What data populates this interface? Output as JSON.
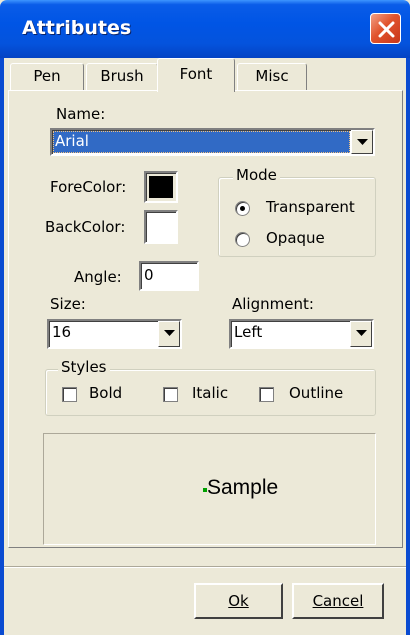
{
  "window": {
    "title": "Attributes",
    "close_label": "close"
  },
  "tabs": [
    {
      "label": "Pen",
      "active": false
    },
    {
      "label": "Brush",
      "active": false
    },
    {
      "label": "Font",
      "active": true
    },
    {
      "label": "Misc",
      "active": false
    }
  ],
  "font": {
    "name_label": "Name:",
    "name_value": "Arial",
    "forecolor_label": "ForeColor:",
    "forecolor": "#000000",
    "backcolor_label": "BackColor:",
    "backcolor": "#ffffff",
    "mode": {
      "title": "Mode",
      "options": [
        "Transparent",
        "Opaque"
      ],
      "selected": "Transparent"
    },
    "angle_label": "Angle:",
    "angle_value": "0",
    "size_label": "Size:",
    "size_value": "16",
    "alignment_label": "Alignment:",
    "alignment_value": "Left",
    "styles": {
      "title": "Styles",
      "options": [
        {
          "label": "Bold",
          "checked": false
        },
        {
          "label": "Italic",
          "checked": false
        },
        {
          "label": "Outline",
          "checked": false
        }
      ]
    },
    "sample_text": "Sample",
    "sample_marker_color": "#00a000"
  },
  "buttons": {
    "ok": "Ok",
    "cancel": "Cancel"
  },
  "colors": {
    "titlebar": "#0055e5",
    "selection": "#316ac5",
    "face": "#ece9d8"
  }
}
